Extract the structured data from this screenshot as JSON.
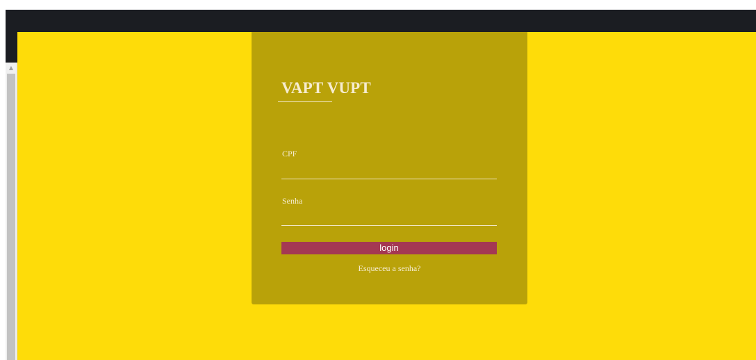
{
  "app": {
    "brand_title": "VAPT VUPT"
  },
  "form": {
    "cpf_label": "CPF",
    "cpf_value": "",
    "senha_label": "Senha",
    "senha_value": "",
    "login_label": "login",
    "forgot_label": "Esqueceu a senha?"
  },
  "scrollbar": {
    "up_arrow_glyph": "▲"
  },
  "colors": {
    "page_background": "#fedc09",
    "card_background": "#b9a209",
    "login_button": "#a43853",
    "top_bar": "#1b1d22",
    "text_light": "#f6ecd0"
  }
}
